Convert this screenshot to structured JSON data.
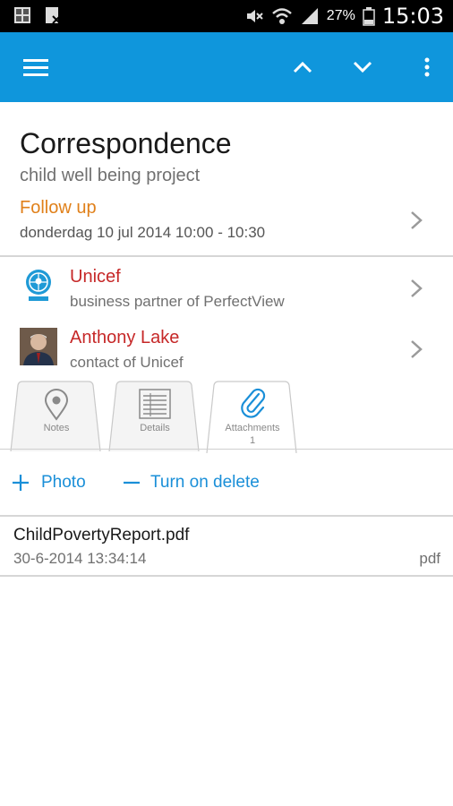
{
  "status_bar": {
    "battery_percent": "27%",
    "time": "15:03"
  },
  "app_bar": {
    "colors": {
      "background": "#0f96dc"
    },
    "icons": [
      "menu-icon",
      "chevron-up-icon",
      "chevron-down-icon",
      "overflow-menu-icon"
    ]
  },
  "record": {
    "title": "Correspondence",
    "subtitle": "child well being project",
    "follow_up": {
      "label": "Follow up",
      "datetime": "donderdag 10 jul 2014 10:00 - 10:30"
    }
  },
  "contacts": [
    {
      "name": "Unicef",
      "relation": "business partner of PerfectView",
      "avatar": "unicef-logo"
    },
    {
      "name": "Anthony Lake",
      "relation": "contact of Unicef",
      "avatar": "person-photo"
    }
  ],
  "tabs": [
    {
      "label": "Notes",
      "icon": "location-pin-icon",
      "badge": ""
    },
    {
      "label": "Details",
      "icon": "details-list-icon",
      "badge": ""
    },
    {
      "label": "Attachments",
      "icon": "paperclip-icon",
      "badge": "1",
      "active": true
    }
  ],
  "actions": {
    "add_photo": "Photo",
    "turn_on_delete": "Turn on delete"
  },
  "attachments": [
    {
      "name": "ChildPovertyReport.pdf",
      "date": "30-6-2014 13:34:14",
      "type": "pdf"
    }
  ],
  "colors": {
    "accent": "#0f96dc",
    "follow_up": "#e0801a",
    "contact_name": "#c62828",
    "action": "#1a8fd8"
  }
}
